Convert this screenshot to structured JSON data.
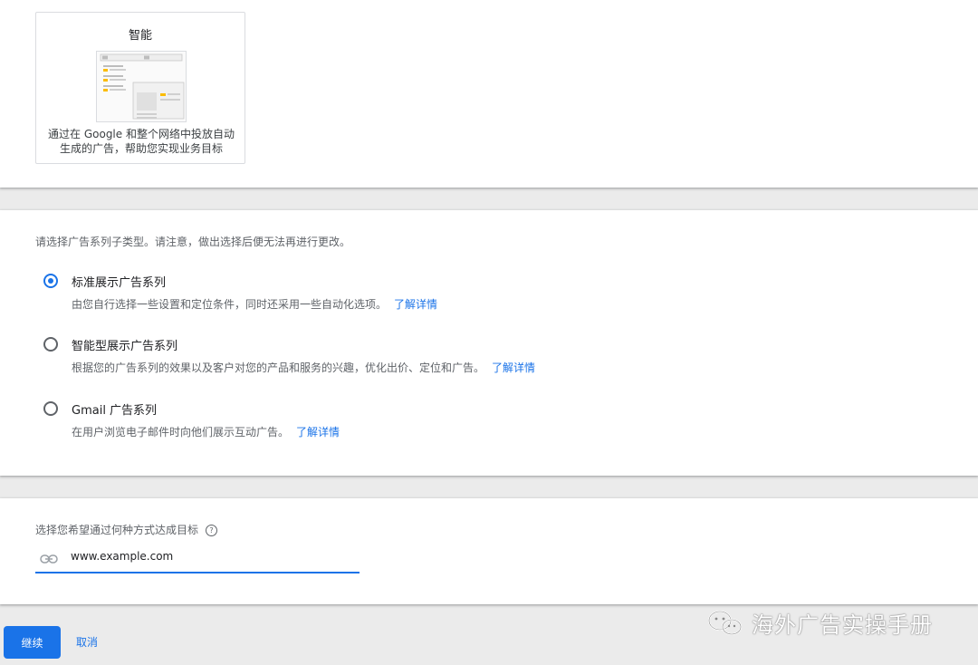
{
  "goal_tile": {
    "title": "智能",
    "description": "通过在 Google 和整个网络中投放自动生成的广告，帮助您实现业务目标"
  },
  "subtype": {
    "prompt": "请选择广告系列子类型。请注意，做出选择后便无法再进行更改。",
    "options": [
      {
        "title": "标准展示广告系列",
        "desc": "由您自行选择一些设置和定位条件，同时还采用一些自动化选项。",
        "link": "了解详情",
        "selected": true
      },
      {
        "title": "智能型展示广告系列",
        "desc": "根据您的广告系列的效果以及客户对您的产品和服务的兴趣，优化出价、定位和广告。",
        "link": "了解详情",
        "selected": false
      },
      {
        "title": "Gmail 广告系列",
        "desc": "在用户浏览电子邮件时向他们展示互动广告。",
        "link": "了解详情",
        "selected": false
      }
    ]
  },
  "url_section": {
    "label": "选择您希望通过何种方式达成目标",
    "help_icon": "?",
    "value": "www.example.com"
  },
  "footer": {
    "continue_label": "继续",
    "cancel_label": "取消"
  },
  "watermark": {
    "text": "海外广告实操手册",
    "icon": "wechat-icon"
  },
  "colors": {
    "accent": "#1a73e8",
    "page_background": "#ebebeb",
    "card": "#ffffff",
    "secondary_text": "#5f6368"
  }
}
